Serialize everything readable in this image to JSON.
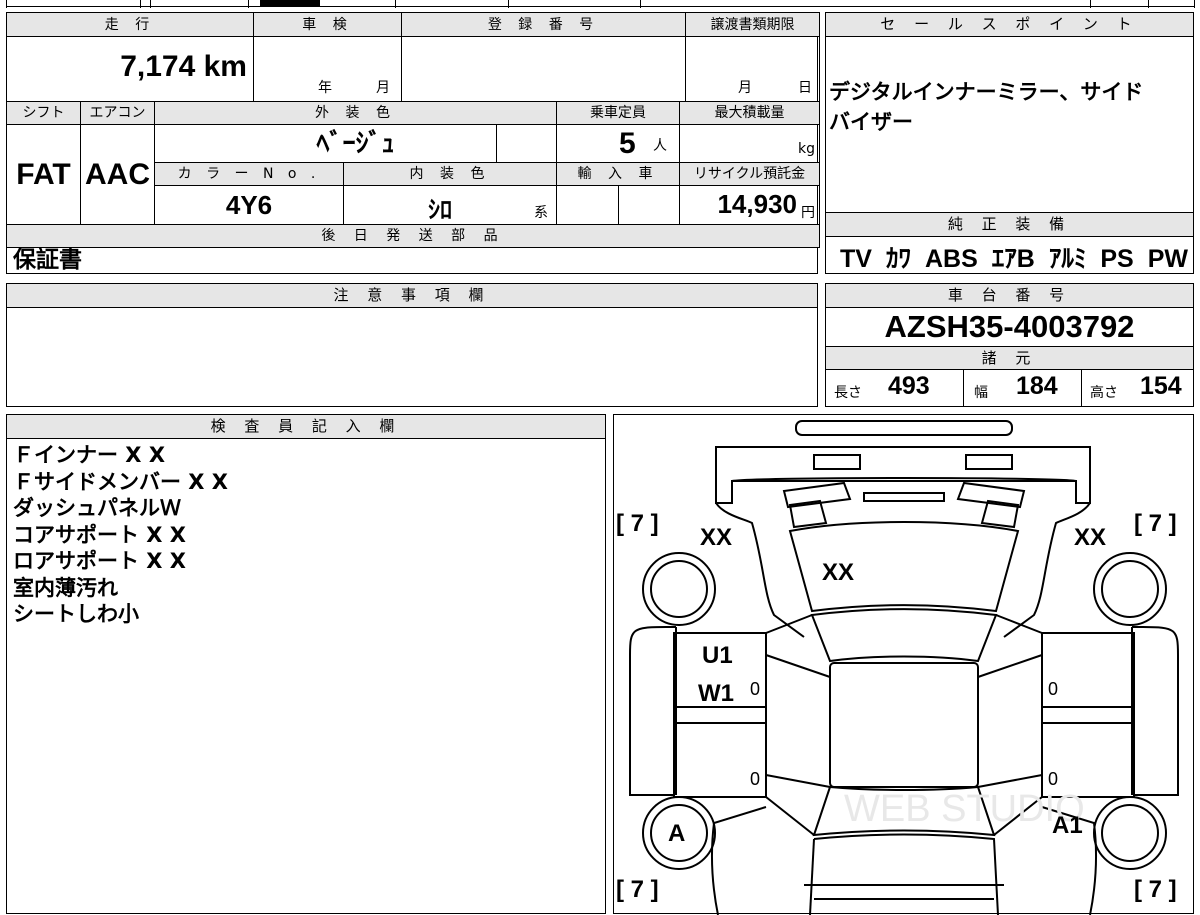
{
  "header": {
    "mileage_label": "走 行",
    "shaken_label": "車 検",
    "registration_label": "登 録 番 号",
    "transfer_deadline_label": "譲渡書類期限",
    "sales_point_label": "セ ー ル ス ポ イ ン ト"
  },
  "vehicle": {
    "mileage": "7,174 km",
    "shaken_year": "年",
    "shaken_month": "月",
    "registration_number": "",
    "deadline_month": "月",
    "deadline_day": "日",
    "shift_label": "シフト",
    "shift": "FAT",
    "aircon_label": "エアコン",
    "aircon": "AAC",
    "exterior_color_label": "外 装 色",
    "exterior_color": "ﾍﾞｰｼﾞｭ",
    "capacity_label": "乗車定員",
    "capacity": "5",
    "capacity_unit": "人",
    "max_load_label": "最大積載量",
    "max_load_unit": "kg",
    "color_no_label": "カ ラ ー N o .",
    "color_no": "4Y6",
    "interior_color_label": "内 装 色",
    "interior_color": "ｼﾛ",
    "interior_suffix": "系",
    "import_label": "輸 入 車",
    "recycle_label": "リサイクル預託金",
    "recycle_fee": "14,930",
    "recycle_unit": "円",
    "later_parts_label": "後 日 発 送 部 品",
    "later_parts": "保証書"
  },
  "sales_point": {
    "text_line1": "デジタルインナーミラー、サイド",
    "text_line2": "バイザー"
  },
  "equipment": {
    "label": "純 正 装 備",
    "items": [
      "TV",
      "ｶﾜ",
      "ABS",
      "ｴｱB",
      "ｱﾙﾐ",
      "PS",
      "PW"
    ]
  },
  "notes": {
    "label": "注 意 事 項 欄",
    "text": ""
  },
  "chassis": {
    "label": "車 台 番 号",
    "number": "AZSH35-4003792"
  },
  "specs": {
    "label": "諸 元",
    "length_label": "長さ",
    "length": "493",
    "width_label": "幅",
    "width": "184",
    "height_label": "高さ",
    "height": "154"
  },
  "inspector": {
    "label": "検 査 員 記 入 欄",
    "lines": [
      "Ｆインナー X X",
      "Ｆサイドメンバー X X",
      "ダッシュパネルＷ",
      "コアサポート X X",
      "ロアサポート X X",
      "室内薄汚れ",
      "シートしわ小"
    ]
  },
  "diagram": {
    "tire_fl": "[ 7 ]",
    "tire_fr": "[ 7 ]",
    "tire_rl": "[ 7 ]",
    "tire_rr": "[ 7 ]",
    "mark_left_fender": "XX",
    "mark_right_fender": "XX",
    "mark_hood": "XX",
    "mark_left_door_1": "U1",
    "mark_left_door_2": "W1",
    "mark_left_front_small": "0",
    "mark_right_front_small": "0",
    "mark_left_rear_small": "0",
    "mark_right_rear_small": "0",
    "mark_rear_left_wheel": "A",
    "mark_rear_right": "A1",
    "watermark": "WEB STUDIO"
  }
}
